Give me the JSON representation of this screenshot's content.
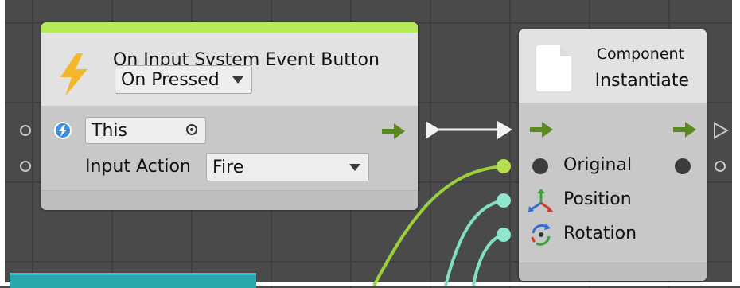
{
  "event_node": {
    "title": "On Input System Event Button",
    "mode": "On Pressed",
    "target": "This",
    "input_action_label": "Input Action",
    "input_action": "Fire",
    "accent_color": "#b6ea5a"
  },
  "component_node": {
    "kind": "Component",
    "name": "Instantiate",
    "ports": [
      {
        "label": "Original",
        "icon": "filled-dot-icon"
      },
      {
        "label": "Position",
        "icon": "move-axes-icon"
      },
      {
        "label": "Rotation",
        "icon": "rotate-icon"
      }
    ]
  },
  "colors": {
    "background": "#4a4a4a",
    "flow_arrow": "#5a8a1e",
    "wire_original": "#9dcf3c",
    "wire_vector": "#7fe0c4"
  }
}
